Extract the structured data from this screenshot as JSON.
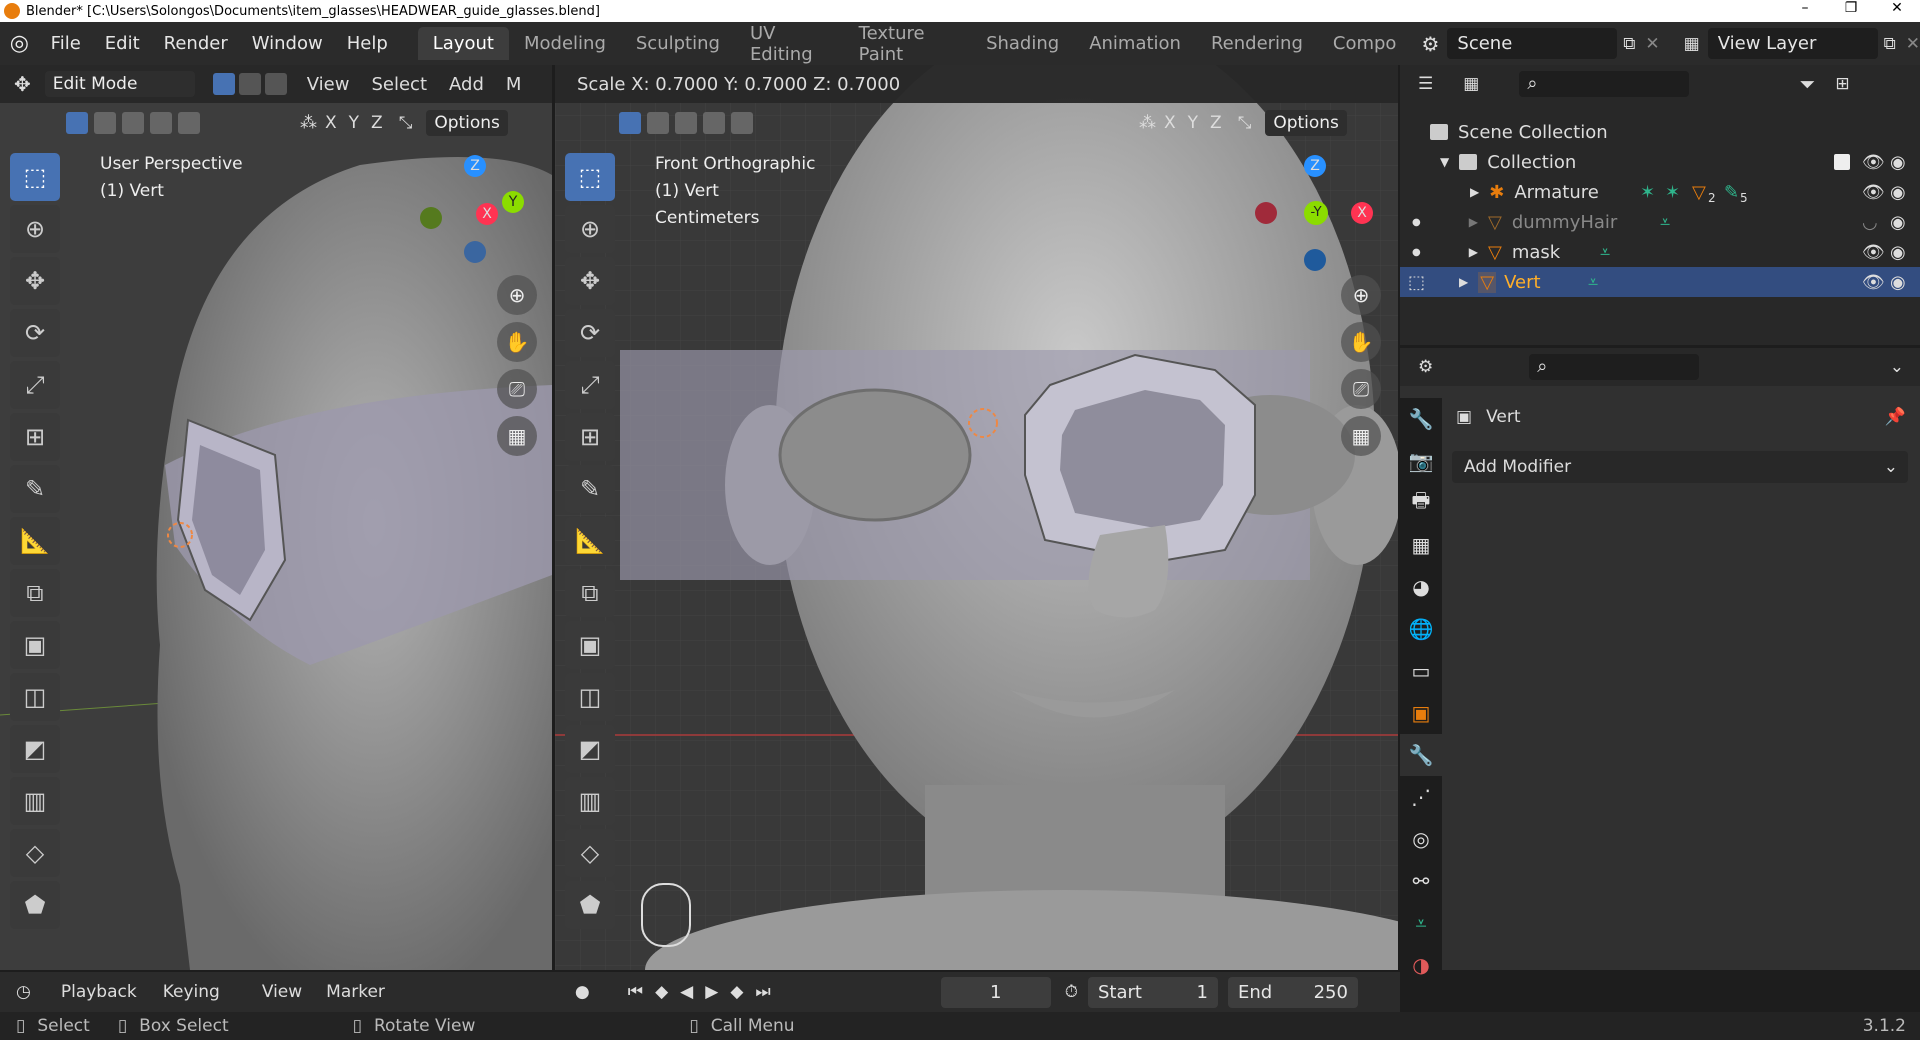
{
  "titlebar": {
    "title": "Blender* [C:\\Users\\Solongos\\Documents\\item_glasses\\HEADWEAR_guide_glasses.blend]",
    "min": "–",
    "max": "❐",
    "close": "✕"
  },
  "menu": {
    "items": [
      "File",
      "Edit",
      "Render",
      "Window",
      "Help"
    ]
  },
  "workspaces": {
    "tabs": [
      "Layout",
      "Modeling",
      "Sculpting",
      "UV Editing",
      "Texture Paint",
      "Shading",
      "Animation",
      "Rendering",
      "Compo"
    ],
    "active": "Layout"
  },
  "scene": {
    "label": "Scene"
  },
  "viewlayer": {
    "label": "View Layer"
  },
  "vp_left": {
    "mode": "Edit Mode",
    "menus": [
      "View",
      "Select",
      "Add",
      "M"
    ],
    "axes": [
      "X",
      "Y",
      "Z"
    ],
    "options": "Options",
    "perspective": "User Perspective",
    "object": "(1) Vert"
  },
  "vp_right": {
    "status": "Scale X: 0.7000   Y: 0.7000   Z: 0.7000",
    "axes": [
      "X",
      "Y",
      "Z"
    ],
    "options": "Options",
    "perspective": "Front Orthographic",
    "object": "(1) Vert",
    "units": "Centimeters"
  },
  "gizmo": {
    "x": "X",
    "y": "Y",
    "z": "Z",
    "neg_y": "-Y"
  },
  "outliner": {
    "rows": [
      {
        "label": "Scene Collection"
      },
      {
        "label": "Collection"
      },
      {
        "label": "Armature",
        "badge1": "2",
        "badge2": "5"
      },
      {
        "label": "dummyHair"
      },
      {
        "label": "mask"
      },
      {
        "label": "Vert"
      }
    ]
  },
  "properties": {
    "object_name": "Vert",
    "add_modifier": "Add Modifier"
  },
  "timeline": {
    "menus": [
      "Playback",
      "Keying",
      "View",
      "Marker"
    ],
    "frame": "1",
    "start_label": "Start",
    "start": "1",
    "end_label": "End",
    "end": "250"
  },
  "statusbar": {
    "select": "Select",
    "box_select": "Box Select",
    "rotate": "Rotate View",
    "call_menu": "Call Menu",
    "version": "3.1.2"
  },
  "colors": {
    "accent": "#4772b3",
    "selected_row": "#334d80",
    "x_axis": "#ff3352",
    "y_axis": "#8bdc00",
    "z_axis": "#2890ff",
    "orange": "#e87d0d"
  }
}
